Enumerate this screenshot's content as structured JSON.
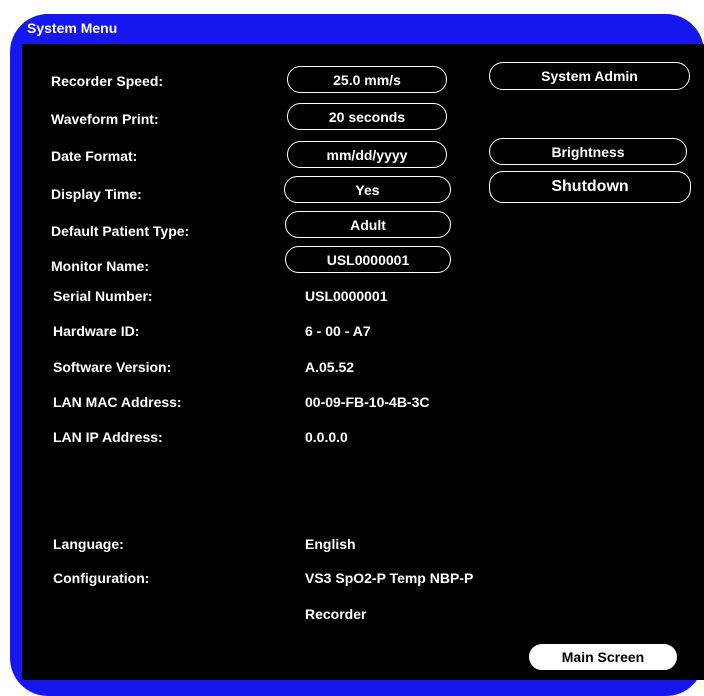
{
  "window": {
    "title": "System Menu"
  },
  "settings": [
    {
      "label": "Recorder Speed:",
      "value": "25.0 mm/s"
    },
    {
      "label": "Waveform Print:",
      "value": "20 seconds"
    },
    {
      "label": "Date Format:",
      "value": "mm/dd/yyyy"
    },
    {
      "label": "Display Time:",
      "value": "Yes"
    },
    {
      "label": "Default Patient Type:",
      "value": "Adult"
    },
    {
      "label": "Monitor Name:",
      "value": "USL0000001"
    }
  ],
  "info": [
    {
      "label": "Serial Number:",
      "value": "USL0000001"
    },
    {
      "label": "Hardware ID:",
      "value": "6 - 00 - A7"
    },
    {
      "label": "Software Version:",
      "value": "A.05.52"
    },
    {
      "label": "LAN MAC Address:",
      "value": "00-09-FB-10-4B-3C"
    },
    {
      "label": "LAN IP Address:",
      "value": "0.0.0.0"
    }
  ],
  "language": {
    "label": "Language:",
    "value": "English"
  },
  "configuration": {
    "label": "Configuration:",
    "value": "VS3 SpO2-P Temp NBP-P",
    "value2": "Recorder"
  },
  "actions": {
    "system_admin": "System Admin",
    "brightness": "Brightness",
    "shutdown": "Shutdown",
    "main_screen": "Main Screen"
  }
}
